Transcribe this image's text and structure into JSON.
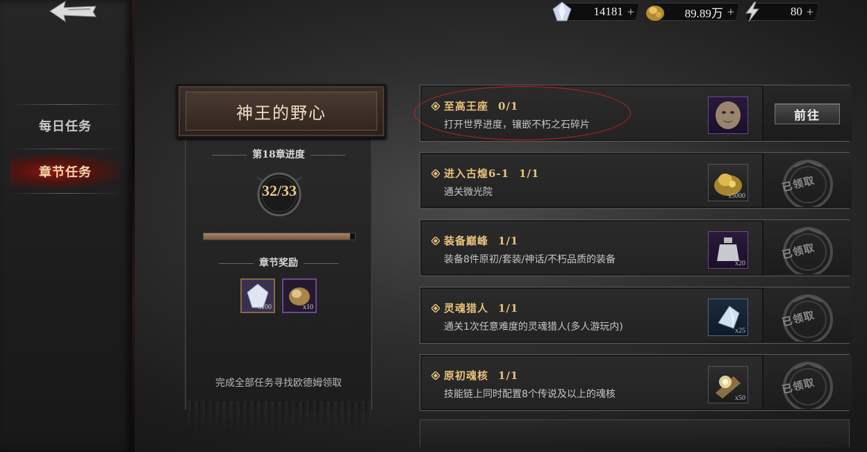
{
  "nav": {
    "items": [
      {
        "label": "每日任务"
      },
      {
        "label": "章节任务"
      }
    ]
  },
  "currency": [
    {
      "icon": "crystal-icon",
      "value": "14181"
    },
    {
      "icon": "gold-icon",
      "value": "89.89万"
    },
    {
      "icon": "energy-icon",
      "value": "80"
    }
  ],
  "chapter": {
    "title": "神王的野心",
    "progress_label": "第18章进度",
    "progress_text": "32/33",
    "progress_fraction": 0.97,
    "reward_label": "章节奖励",
    "rewards": [
      {
        "icon": "crystal-reward-icon",
        "qty": "x100"
      },
      {
        "icon": "gold-reward-icon",
        "qty": "x10"
      }
    ],
    "footer": "完成全部任务寻找欧德姆领取"
  },
  "tasks": [
    {
      "name": "至高王座",
      "progress": "0/1",
      "desc": "打开世界进度，镶嵌不朽之石碎片",
      "item_icon": "face-relic-icon",
      "item_qty": "",
      "action": "前往",
      "claimed": false
    },
    {
      "name": "进入古煌6-1",
      "progress": "1/1",
      "desc": "通关微光院",
      "item_icon": "gold-pile-icon",
      "item_qty": "x5000",
      "claimed": true
    },
    {
      "name": "装备巅峰",
      "progress": "1/1",
      "desc": "装备8件原初/套装/神话/不朽品质的装备",
      "item_icon": "potion-icon",
      "item_qty": "x20",
      "claimed": true
    },
    {
      "name": "灵魂猎人",
      "progress": "1/1",
      "desc": "通关1次任意难度的灵魂猎人(多人游玩内)",
      "item_icon": "crystal-shard-icon",
      "item_qty": "x25",
      "claimed": true
    },
    {
      "name": "原初魂核",
      "progress": "1/1",
      "desc": "技能链上同时配置8个传说及以上的魂核",
      "item_icon": "soul-core-icon",
      "item_qty": "x50",
      "claimed": true
    }
  ],
  "claimed_stamp": "已领取",
  "colors": {
    "accent_gold": "#e8c27a",
    "active_red": "#a0140a",
    "highlight": "#d02020"
  }
}
